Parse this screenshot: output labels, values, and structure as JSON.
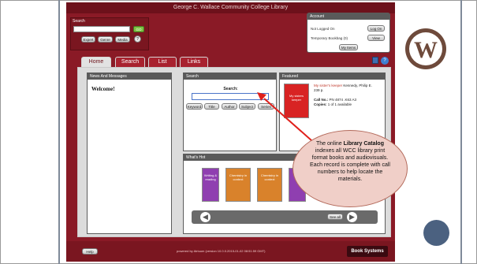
{
  "app": {
    "title": "George C. Wallace Community College Library"
  },
  "search_box": {
    "title": "Search",
    "go_label": "GO",
    "buttons": [
      "Expert",
      "Genre",
      "Media"
    ],
    "help_label": "?"
  },
  "account": {
    "title": "Account",
    "status_label": "Not Logged On",
    "log_on_label": "Log On",
    "bookbag_label": "Temporary Bookbag (0)",
    "view_label": "View",
    "my_items_label": "My Items"
  },
  "tabs": [
    "Home",
    "Search",
    "List",
    "Links"
  ],
  "news": {
    "title": "News And Messages",
    "welcome": "Welcome!"
  },
  "center_search": {
    "title": "Search",
    "label": "Search:",
    "buttons": [
      "Keyword",
      "Title",
      "Author",
      "Subject",
      "Series"
    ]
  },
  "featured": {
    "title": "Featured",
    "cover_text": "My sisters keeper",
    "item_title": "My sister's keeper",
    "item_author": "Kennedy, Philip E.",
    "item_pages": "239 p.",
    "call_no_label": "Call No.:",
    "call_no": "PN 4874 .K63 A3",
    "copies_label": "Copies:",
    "copies": "1 of 1 available"
  },
  "whats_hot": {
    "title": "What's Hot",
    "books": [
      {
        "label": "Writing & reading",
        "color": "#8f3fb0"
      },
      {
        "label": "Chemistry in context",
        "color": "#d9822b"
      },
      {
        "label": "Chemistry in context",
        "color": "#d9822b"
      },
      {
        "label": "",
        "color": "#8f3fb0"
      }
    ],
    "see_all_label": "See all"
  },
  "footer": {
    "help_label": "Help",
    "powered_by": "powered by Atriuum (version 10.0.0.2015-01-02 08:51:59 GMT)",
    "brand": "Book Systems"
  },
  "callout": {
    "text_before": "The online ",
    "bold": "Library Catalog",
    "text_after": " indexes all WCC library print format books and audiovisuals. Each record is complete with call numbers to help locate the materials."
  },
  "logo": {
    "letter": "W"
  }
}
